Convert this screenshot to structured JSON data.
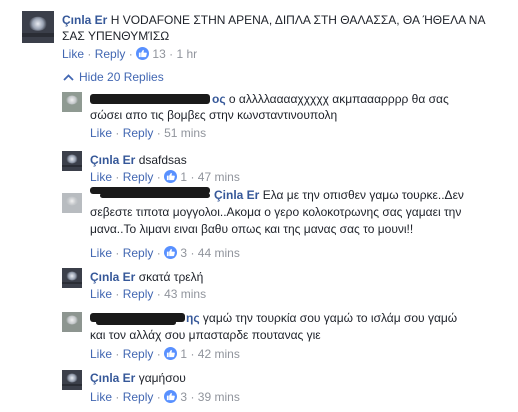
{
  "top_comment": {
    "author": "Çınla Er",
    "text_line1": "Η VODAFONE ΣΤΗΝ ΑΡΕΝΑ, ΔΙΠΛΑ ΣΤΗ ΘΑΛΑΣΣΑ, ΘΑ ΉΘΕΛΑ ΝΑ",
    "text_line2": "ΣΑΣ ΥΠΕΝΘΥΜΊΣΩ",
    "like": "Like",
    "reply": "Reply",
    "reactions": "13",
    "time": "1 hr"
  },
  "hide_replies": "Hide 20 Replies",
  "separator": "·",
  "replies": [
    {
      "author_visible_suffix": "ος",
      "text_line1": "ο αλλλλααααχχχχχ ακμπαααρρρρ θα σας",
      "text_line2": "σώσει απο τις βομβες στην κωνσταντινουπολη",
      "like": "Like",
      "reply": "Reply",
      "time": "51 mins"
    },
    {
      "author": "Çınla Er",
      "text_line1": "dsafdsas",
      "like": "Like",
      "reply": "Reply",
      "reactions": "1",
      "time": "47 mins"
    },
    {
      "mention": "Çinla Er",
      "text_line1": "Ελα με την οπισθεν γαμω τουρκε..Δεν",
      "text_line2": "σεβεστε τιποτα μογγολοι..Ακομα ο γερο κολοκοτρωνης σας γαμαει την",
      "text_line3": "μανα..Το λιμανι ειναι βαθυ οπως και της μανας σας το μουνι!!",
      "like": "Like",
      "reply": "Reply",
      "reactions": "3",
      "time": "44 mins"
    },
    {
      "author": "Çınla Er",
      "text_line1": "σκατά τρελή",
      "like": "Like",
      "reply": "Reply",
      "time": "43 mins"
    },
    {
      "author_visible_suffix": "ης",
      "text_line1": "γαμώ την τουρκία σου γαμώ το ισλάμ σου γαμώ",
      "text_line2": "και τον αλλάχ σου μπασταρδε πουτανας γιε",
      "like": "Like",
      "reply": "Reply",
      "reactions": "1",
      "time": "42 mins"
    },
    {
      "author": "Çınla Er",
      "text_line1": "γαμήσου",
      "like": "Like",
      "reply": "Reply",
      "reactions": "3",
      "time": "39 mins"
    }
  ],
  "icons": {
    "like_badge": "thumbs-up-icon",
    "collapse": "chevron-up-icon"
  },
  "colors": {
    "link": "#4267b2",
    "name": "#365899",
    "meta": "#90949c",
    "like_badge": "#5890ff"
  }
}
